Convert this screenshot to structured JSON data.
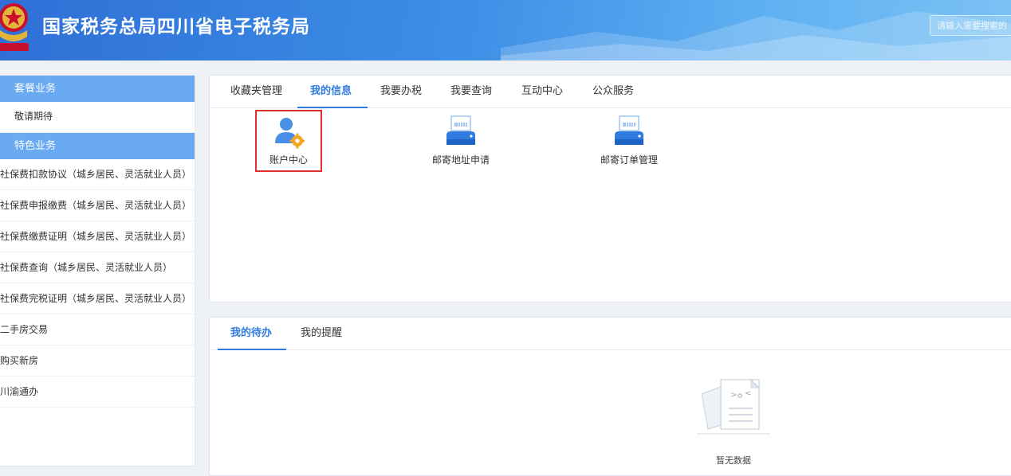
{
  "header": {
    "title": "国家税务总局四川省电子税务局",
    "search_placeholder": "请输入需要搜索的"
  },
  "sidebar": {
    "sections": [
      {
        "title": "套餐业务",
        "items": [
          "敬请期待"
        ]
      },
      {
        "title": "特色业务",
        "items": [
          "社保费扣款协议（城乡居民、灵活就业人员）",
          "社保费申报缴费（城乡居民、灵活就业人员）",
          "社保费缴费证明（城乡居民、灵活就业人员）",
          "社保费查询（城乡居民、灵活就业人员）",
          "社保费完税证明（城乡居民、灵活就业人员）",
          "二手房交易",
          "购买新房",
          "川渝通办"
        ]
      }
    ]
  },
  "top_panel": {
    "tabs": [
      "收藏夹管理",
      "我的信息",
      "我要办税",
      "我要查询",
      "互动中心",
      "公众服务"
    ],
    "active_tab": "我的信息",
    "services": [
      {
        "label": "账户中心",
        "icon": "user-gear-icon"
      },
      {
        "label": "邮寄地址申请",
        "icon": "printer-icon"
      },
      {
        "label": "邮寄订单管理",
        "icon": "printer-icon"
      }
    ]
  },
  "bottom_panel": {
    "tabs": [
      "我的待办",
      "我的提醒"
    ],
    "active_tab": "我的待办",
    "empty_text": "暂无数据"
  },
  "colors": {
    "accent": "#2f7be0",
    "sidebar_section": "#6aaaf0",
    "highlight_border": "#e03030"
  }
}
